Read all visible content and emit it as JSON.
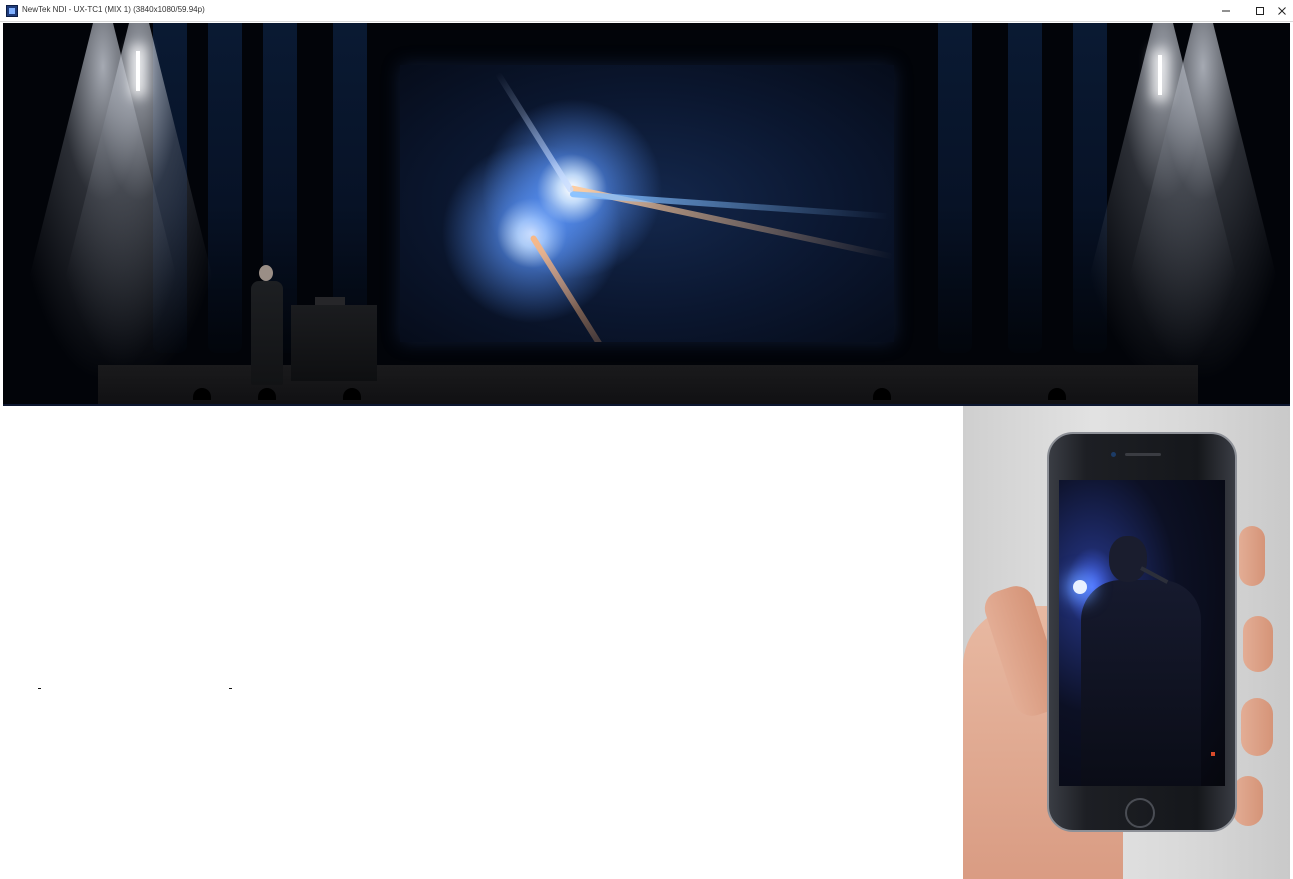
{
  "window": {
    "title": "NewTek NDI - UX-TC1 (MIX 1) (3840x1080/59.94p)",
    "controls": {
      "minimize": "minimize-icon",
      "maximize": "maximize-icon",
      "close": "close-icon"
    }
  },
  "video": {
    "main_feed": "stage-video",
    "inset_feed": "phone-photo"
  },
  "colors": {
    "titlebar_bg": "#ffffff",
    "stage_bg": "#020409",
    "page_bg": "#ffffff"
  }
}
